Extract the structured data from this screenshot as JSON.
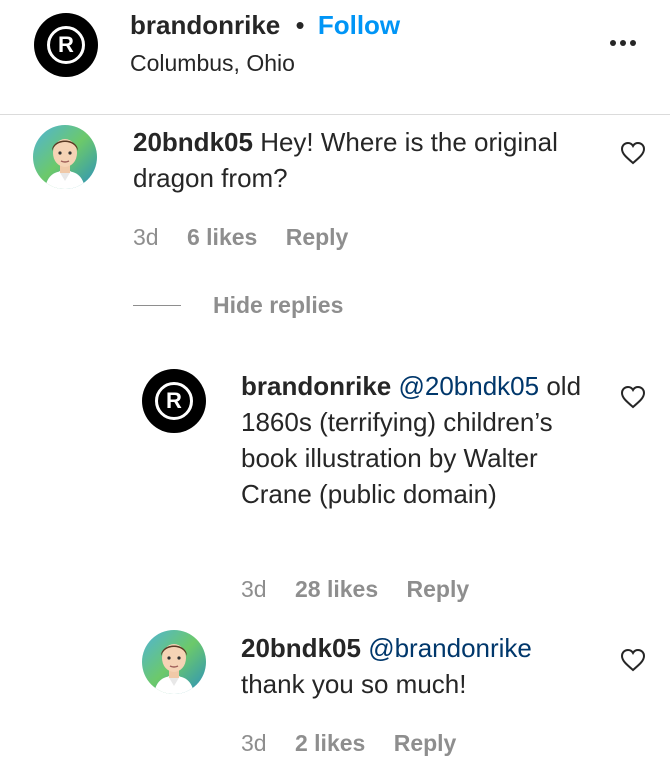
{
  "header": {
    "username": "brandonrike",
    "separator": "•",
    "follow_label": "Follow",
    "location": "Columbus, Ohio",
    "more_icon": "ellipsis-icon",
    "avatar_letter": "R"
  },
  "comments": [
    {
      "username": "20bndk05",
      "text": "Hey! Where is the original dragon from?",
      "age": "3d",
      "likes": "6 likes",
      "reply_label": "Reply",
      "hide_replies_label": "Hide replies"
    }
  ],
  "replies": [
    {
      "username": "brandonrike",
      "avatar_letter": "R",
      "mention": "@20bndk05",
      "text": "old 1860s (terrifying) children’s book illustration by Walter Crane (public domain)",
      "age": "3d",
      "likes": "28 likes",
      "reply_label": "Reply"
    },
    {
      "username": "20bndk05",
      "mention": "@brandonrike",
      "text": "thank you so much!",
      "age": "3d",
      "likes": "2 likes",
      "reply_label": "Reply"
    }
  ],
  "colors": {
    "follow_blue": "#0095f6",
    "mention_blue": "#00376b",
    "meta_gray": "#8e8e8e"
  }
}
